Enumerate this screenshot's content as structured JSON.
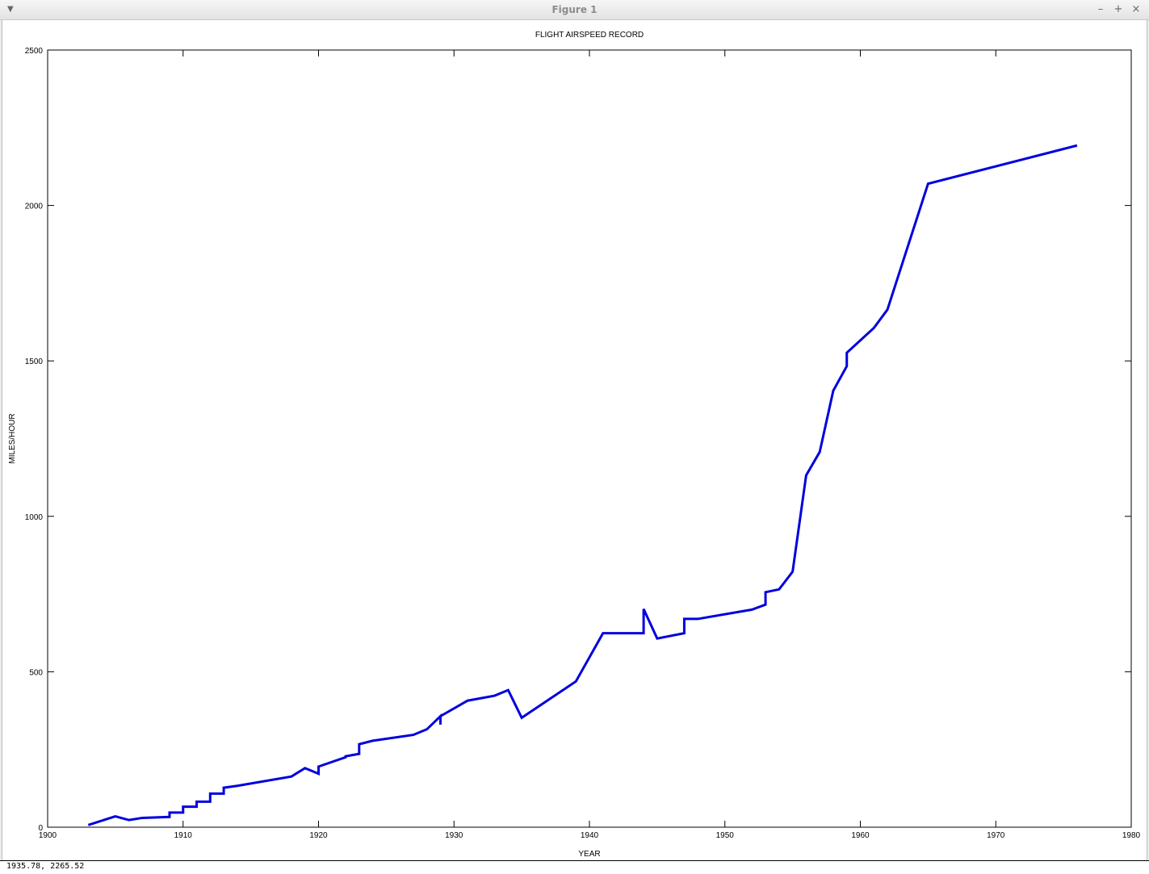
{
  "window": {
    "title": "Figure 1",
    "menu_icon": "chevron-down-icon",
    "minimize_glyph": "–",
    "maximize_glyph": "+",
    "close_glyph": "×"
  },
  "status": {
    "coordinates": "1935.78,  2265.52"
  },
  "chart_data": {
    "type": "line",
    "title": "FLIGHT AIRSPEED RECORD",
    "xlabel": "YEAR",
    "ylabel": "MILES/HOUR",
    "xlim": [
      1900,
      1980
    ],
    "ylim": [
      0,
      2500
    ],
    "xticks": [
      1900,
      1910,
      1920,
      1930,
      1940,
      1950,
      1960,
      1970,
      1980
    ],
    "yticks": [
      0,
      500,
      1000,
      1500,
      2000,
      2500
    ],
    "grid": false,
    "line_color": "#0000dd",
    "series": [
      {
        "x": [
          1903,
          1905,
          1906,
          1907,
          1909,
          1909,
          1910,
          1910,
          1911,
          1911,
          1912,
          1912,
          1913,
          1913,
          1914,
          1918,
          1919,
          1920,
          1920,
          1922,
          1922,
          1923,
          1923,
          1924,
          1927,
          1928,
          1929,
          1929,
          1929,
          1931,
          1933,
          1934,
          1935,
          1939,
          1941,
          1944,
          1944,
          1945,
          1947,
          1947,
          1948,
          1952,
          1953,
          1953,
          1954,
          1955,
          1956,
          1957,
          1958,
          1959,
          1959,
          1961,
          1962,
          1965,
          1976
        ],
        "y": [
          7,
          35,
          23,
          30,
          33,
          47,
          47,
          66,
          66,
          82,
          82,
          108,
          108,
          127,
          133,
          163,
          190,
          172,
          195,
          225,
          228,
          236,
          267,
          278,
          297,
          315,
          357,
          330,
          357,
          407,
          423,
          441,
          352,
          469,
          624,
          624,
          702,
          607,
          624,
          670,
          670,
          700,
          716,
          756,
          765,
          822,
          1132,
          1207,
          1404,
          1483,
          1526,
          1606,
          1665,
          2070,
          2193
        ]
      }
    ]
  }
}
